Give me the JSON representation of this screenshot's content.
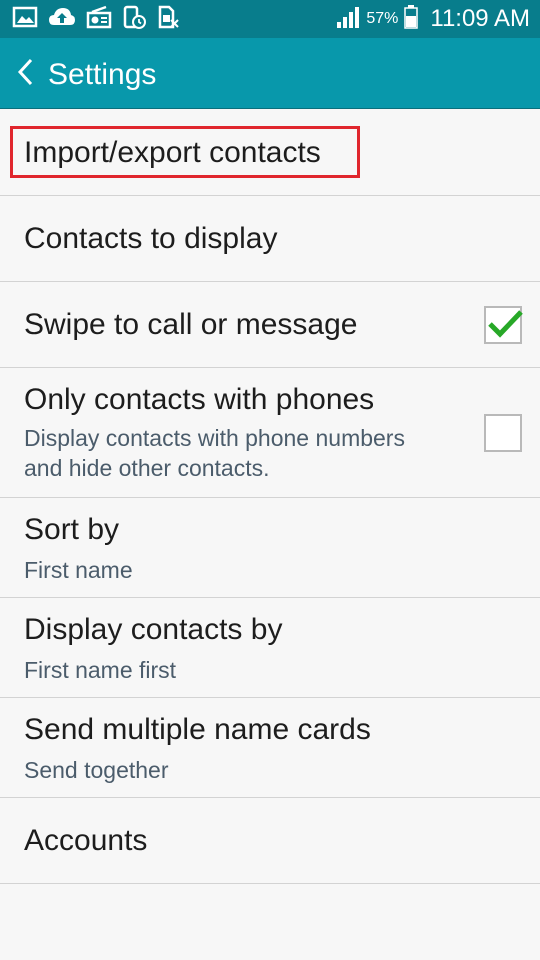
{
  "status_bar": {
    "battery_percent": "57%",
    "time": "11:09 AM",
    "icons": [
      "gallery-icon",
      "cloud-upload-icon",
      "radio-icon",
      "phone-clock-icon",
      "sim-card-blocked-icon",
      "signal-icon",
      "battery-icon"
    ]
  },
  "action_bar": {
    "back_icon": "chevron-left-icon",
    "title": "Settings"
  },
  "settings": {
    "import_export": {
      "title": "Import/export contacts",
      "highlighted": true
    },
    "contacts_to_display": {
      "title": "Contacts to display"
    },
    "swipe_to_call": {
      "title": "Swipe to call or message",
      "checked": true
    },
    "only_with_phones": {
      "title": "Only contacts with phones",
      "summary": "Display contacts with phone numbers and hide other contacts.",
      "summary_line1": "Display contacts with phone numbers",
      "summary_line2": "and hide other contacts.",
      "checked": false
    },
    "sort_by": {
      "title": "Sort by",
      "summary": "First name"
    },
    "display_by": {
      "title": "Display contacts by",
      "summary": "First name first"
    },
    "send_cards": {
      "title": "Send multiple name cards",
      "summary": "Send together"
    },
    "accounts": {
      "title": "Accounts"
    }
  },
  "colors": {
    "status_bar": "#087d8c",
    "action_bar": "#0898ab",
    "check": "#27a827",
    "highlight": "#e0262d"
  }
}
